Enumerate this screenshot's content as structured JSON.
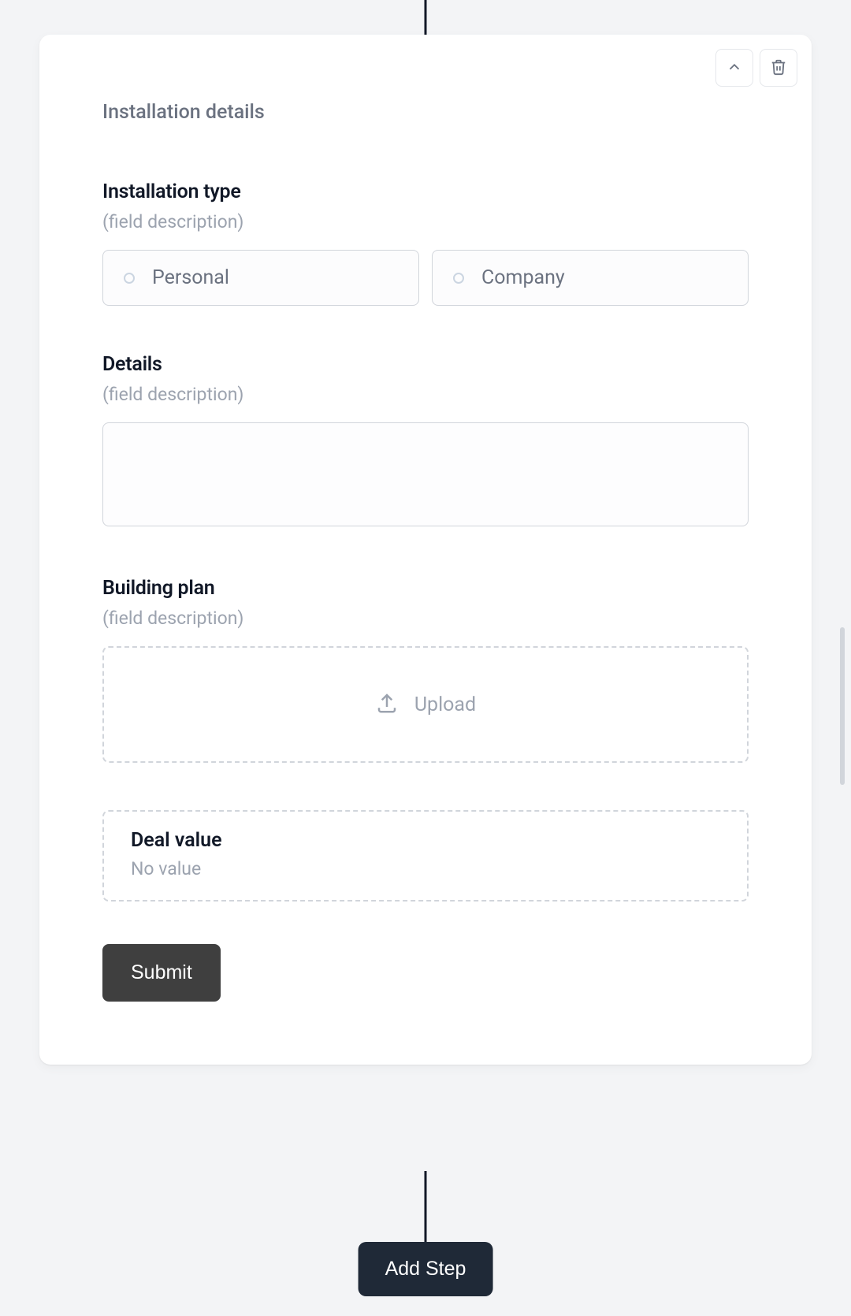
{
  "card": {
    "title": "Installation details",
    "fields": {
      "installation_type": {
        "label": "Installation type",
        "description": "(field description)",
        "options": [
          {
            "label": "Personal"
          },
          {
            "label": "Company"
          }
        ]
      },
      "details": {
        "label": "Details",
        "description": "(field description)",
        "value": ""
      },
      "building_plan": {
        "label": "Building plan",
        "description": "(field description)",
        "upload_label": "Upload"
      },
      "deal_value": {
        "label": "Deal value",
        "value": "No value"
      }
    },
    "submit_label": "Submit"
  },
  "add_step_label": "Add Step"
}
